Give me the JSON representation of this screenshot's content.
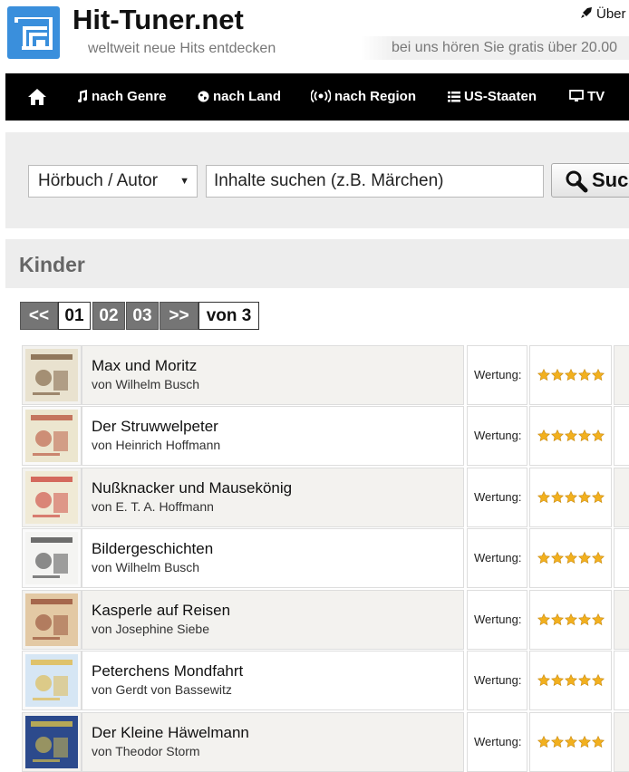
{
  "header": {
    "site_title": "Hit-Tuner.net",
    "tagline": "weltweit neue Hits entdecken",
    "top_right_link": "Über",
    "ticker_text": "bei uns hören Sie gratis über 20.00"
  },
  "nav": {
    "home_icon": "home-icon",
    "items": [
      {
        "label": "nach Genre",
        "icon": "music-note-icon"
      },
      {
        "label": "nach Land",
        "icon": "globe-icon"
      },
      {
        "label": "nach Region",
        "icon": "broadcast-icon"
      },
      {
        "label": "US-Staaten",
        "icon": "list-icon"
      },
      {
        "label": "TV",
        "icon": "monitor-icon"
      }
    ]
  },
  "search": {
    "category_value": "Hörbuch / Autor",
    "placeholder": "Inhalte suchen (z.B. Märchen)",
    "button_label": "Such"
  },
  "category": {
    "title": "Kinder"
  },
  "pagination": {
    "prev": "<<",
    "pages": [
      "01",
      "02",
      "03"
    ],
    "current": "01",
    "next": ">>",
    "total_label": "von 3"
  },
  "rating_label": "Wertung:",
  "items": [
    {
      "title": "Max und Moritz",
      "author": "von Wilhelm Busch",
      "stars": 5
    },
    {
      "title": "Der Struwwelpeter",
      "author": "von Heinrich Hoffmann",
      "stars": 5
    },
    {
      "title": "Nußknacker und Mausekönig",
      "author": "von E. T. A. Hoffmann",
      "stars": 5
    },
    {
      "title": "Bildergeschichten",
      "author": "von Wilhelm Busch",
      "stars": 5
    },
    {
      "title": "Kasperle auf Reisen",
      "author": "von Josephine Siebe",
      "stars": 5
    },
    {
      "title": "Peterchens Mondfahrt",
      "author": "von Gerdt von Bassewitz",
      "stars": 5
    },
    {
      "title": "Der Kleine Häwelmann",
      "author": "von Theodor Storm",
      "stars": 5
    }
  ],
  "colors": {
    "brand_blue": "#3a8fdc",
    "nav_bg": "#000000",
    "star_gold": "#f2b01e",
    "pager_dark": "#757575"
  }
}
